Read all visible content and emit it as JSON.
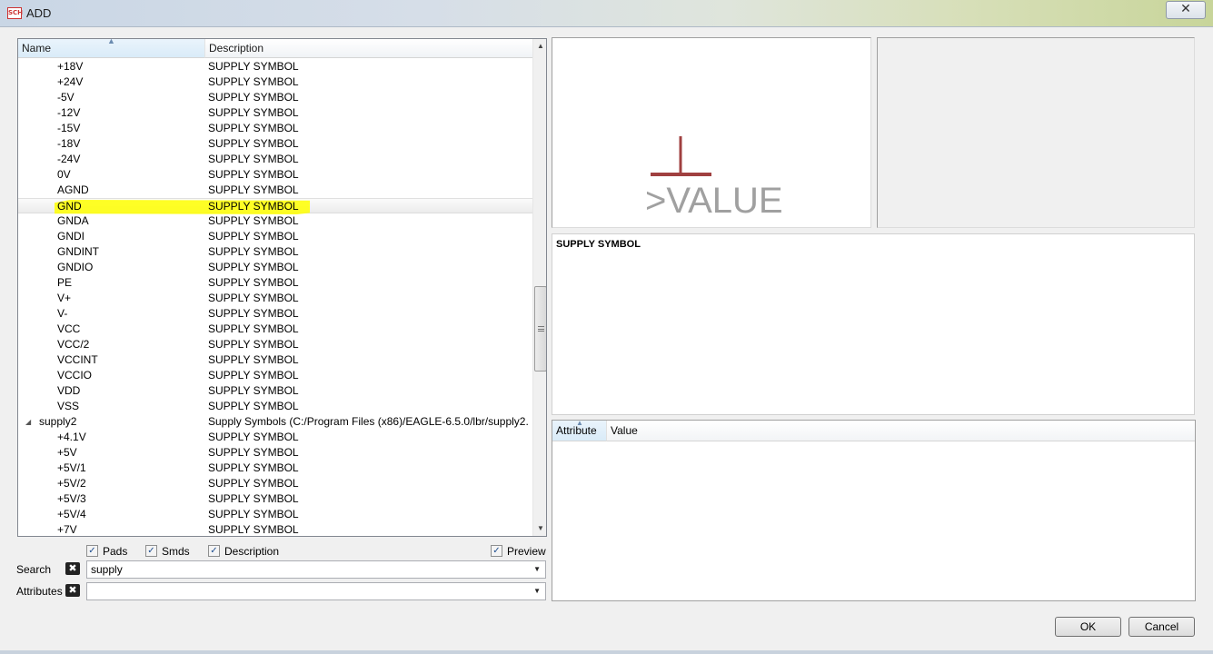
{
  "window": {
    "title": "ADD",
    "app_icon_text": "SCH",
    "close_glyph": "✕"
  },
  "tree": {
    "columns": {
      "name": "Name",
      "description": "Description"
    },
    "rows": [
      {
        "name": "+18V",
        "description": "SUPPLY SYMBOL"
      },
      {
        "name": "+24V",
        "description": "SUPPLY SYMBOL"
      },
      {
        "name": "-5V",
        "description": "SUPPLY SYMBOL"
      },
      {
        "name": "-12V",
        "description": "SUPPLY SYMBOL"
      },
      {
        "name": "-15V",
        "description": "SUPPLY SYMBOL"
      },
      {
        "name": "-18V",
        "description": "SUPPLY SYMBOL"
      },
      {
        "name": "-24V",
        "description": "SUPPLY SYMBOL"
      },
      {
        "name": "0V",
        "description": "SUPPLY SYMBOL"
      },
      {
        "name": "AGND",
        "description": "SUPPLY SYMBOL"
      },
      {
        "name": "GND",
        "description": "SUPPLY SYMBOL"
      },
      {
        "name": "GNDA",
        "description": "SUPPLY SYMBOL"
      },
      {
        "name": "GNDI",
        "description": "SUPPLY SYMBOL"
      },
      {
        "name": "GNDINT",
        "description": "SUPPLY SYMBOL"
      },
      {
        "name": "GNDIO",
        "description": "SUPPLY SYMBOL"
      },
      {
        "name": "PE",
        "description": "SUPPLY SYMBOL"
      },
      {
        "name": "V+",
        "description": "SUPPLY SYMBOL"
      },
      {
        "name": "V-",
        "description": "SUPPLY SYMBOL"
      },
      {
        "name": "VCC",
        "description": "SUPPLY SYMBOL"
      },
      {
        "name": "VCC/2",
        "description": "SUPPLY SYMBOL"
      },
      {
        "name": "VCCINT",
        "description": "SUPPLY SYMBOL"
      },
      {
        "name": "VCCIO",
        "description": "SUPPLY SYMBOL"
      },
      {
        "name": "VDD",
        "description": "SUPPLY SYMBOL"
      },
      {
        "name": "VSS",
        "description": "SUPPLY SYMBOL"
      },
      {
        "name": "supply2",
        "description": "Supply Symbols (C:/Program Files (x86)/EAGLE-6.5.0/lbr/supply2...",
        "is_library": true
      },
      {
        "name": "+4.1V",
        "description": "SUPPLY SYMBOL"
      },
      {
        "name": "+5V",
        "description": "SUPPLY SYMBOL"
      },
      {
        "name": "+5V/1",
        "description": "SUPPLY SYMBOL"
      },
      {
        "name": "+5V/2",
        "description": "SUPPLY SYMBOL"
      },
      {
        "name": "+5V/3",
        "description": "SUPPLY SYMBOL"
      },
      {
        "name": "+5V/4",
        "description": "SUPPLY SYMBOL"
      },
      {
        "name": "+7V",
        "description": "SUPPLY SYMBOL"
      }
    ],
    "selected_row": "GND",
    "scroll_position_fraction": 0.55
  },
  "options": {
    "pads": {
      "label": "Pads",
      "checked": true
    },
    "smds": {
      "label": "Smds",
      "checked": true
    },
    "description": {
      "label": "Description",
      "checked": true
    },
    "preview": {
      "label": "Preview",
      "checked": true
    },
    "check_glyph": "✓"
  },
  "search": {
    "label": "Search",
    "value": "supply",
    "clear_glyph": "✖"
  },
  "attributes": {
    "label": "Attributes",
    "value": "",
    "clear_glyph": "✖"
  },
  "preview": {
    "symbol_text": ">VALUE",
    "symbol_color": "#a04040",
    "symbol_text_color": "#a0a0a0",
    "description": "SUPPLY SYMBOL"
  },
  "attribute_table": {
    "columns": {
      "attribute": "Attribute",
      "value": "Value"
    },
    "rows": []
  },
  "buttons": {
    "ok": "OK",
    "cancel": "Cancel"
  },
  "colors": {
    "highlight": "#ffff00"
  }
}
